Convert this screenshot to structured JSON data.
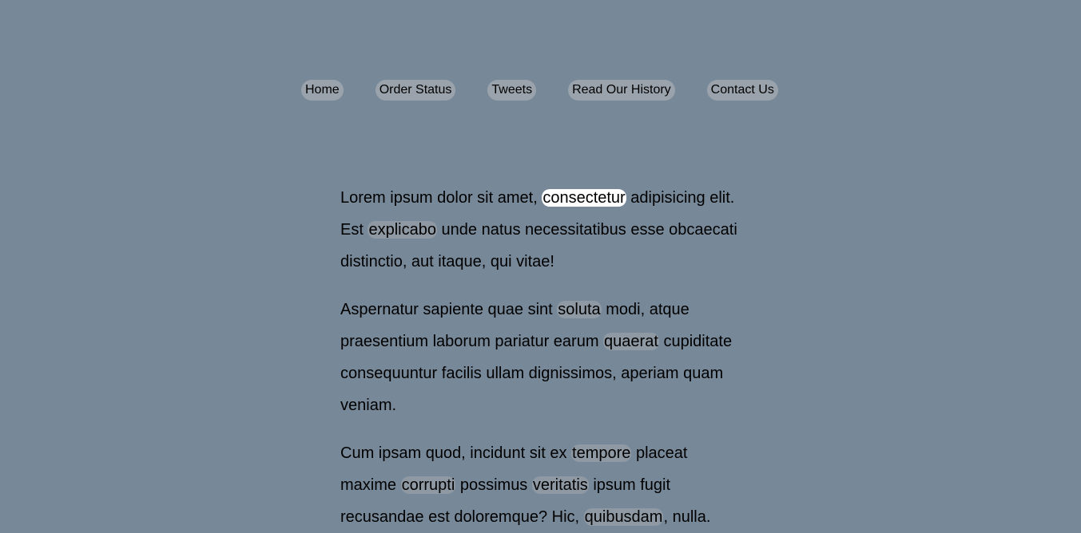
{
  "nav": {
    "items": [
      {
        "label": "Home"
      },
      {
        "label": "Order Status"
      },
      {
        "label": "Tweets"
      },
      {
        "label": "Read Our History"
      },
      {
        "label": "Contact Us"
      }
    ]
  },
  "paragraphs": [
    {
      "segments": [
        {
          "text": "Lorem ipsum dolor sit amet, "
        },
        {
          "text": "consectetur",
          "link": true,
          "active": true
        },
        {
          "text": " adipisicing elit. Est "
        },
        {
          "text": "explicabo",
          "link": true
        },
        {
          "text": " unde natus necessitatibus esse obcaecati distinctio, aut itaque, qui vitae!"
        }
      ]
    },
    {
      "segments": [
        {
          "text": "Aspernatur sapiente quae sint "
        },
        {
          "text": "soluta",
          "link": true
        },
        {
          "text": " modi, atque praesentium laborum pariatur earum "
        },
        {
          "text": "quaerat",
          "link": true
        },
        {
          "text": " cupiditate consequuntur facilis ullam dignissimos, aperiam quam veniam."
        }
      ]
    },
    {
      "segments": [
        {
          "text": "Cum ipsam quod, incidunt sit ex "
        },
        {
          "text": "tempore",
          "link": true
        },
        {
          "text": " placeat maxime "
        },
        {
          "text": "corrupti",
          "link": true
        },
        {
          "text": " possimus "
        },
        {
          "text": "veritatis",
          "link": true
        },
        {
          "text": " ipsum fugit recusandae est doloremque? Hic, "
        },
        {
          "text": "quibusdam",
          "link": true
        },
        {
          "text": ", nulla."
        }
      ]
    }
  ]
}
